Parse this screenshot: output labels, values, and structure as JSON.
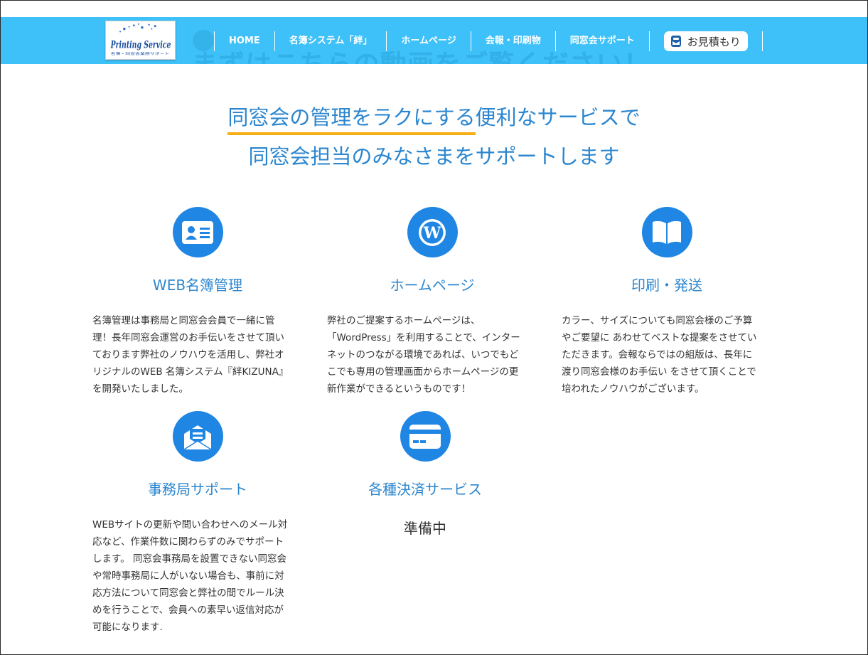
{
  "colors": {
    "nav_bg": "#3ec0f8",
    "accent": "#1f86e3",
    "heading": "#2b86cf",
    "underline": "#f6ae10"
  },
  "logo": {
    "text": "Printing Service",
    "subtext": "名簿・同窓会業務サポート"
  },
  "nav": {
    "background_text": "まずはこちらの動画をご覧ください！",
    "items": [
      "HOME",
      "名簿システム「絆」",
      "ホームページ",
      "会報・印刷物",
      "同窓会サポート"
    ],
    "quote_label": "お見積もり",
    "quote_icon": "mail-box-icon"
  },
  "headline": {
    "line1_underlined": "同窓会の管理をラクにする",
    "line1_rest": "便利なサービスで",
    "line2": "同窓会担当のみなさまをサポートします"
  },
  "features": [
    {
      "icon": "id-card-icon",
      "title": "WEB名簿管理",
      "lines": [
        "名簿管理は事務局と同窓会会員で一緒に管",
        "理！長年同窓会運営のお手伝いをさせて頂い",
        "ております弊社のノウハウを活用し、弊社オ",
        "リジナルのWEB 名簿システム『絆KIZUNA』",
        "を開発いたしました。"
      ]
    },
    {
      "icon": "wordpress-icon",
      "title": "ホームページ",
      "lines": [
        "弊社のご提案するホームページは、",
        "「WordPress」を利用することで、インター",
        "ネットのつながる環境であれば、いつでもど",
        "こでも専用の管理画面からホームページの更",
        "新作業ができるというものです！"
      ]
    },
    {
      "icon": "open-book-icon",
      "title": "印刷・発送",
      "lines": [
        "カラー、サイズについても同窓会様のご予算",
        "やご要望に あわせてベストな提案をさせてい",
        "ただきます。会報ならではの組版は、長年に",
        "渡り同窓会様のお手伝い をさせて頂くことで",
        "培われたノウハウがございます。"
      ]
    },
    {
      "icon": "envelope-letter-icon",
      "title": "事務局サポート",
      "lines": [
        "WEBサイトの更新や問い合わせへのメール対",
        "応など、作業件数に関わらずのみでサポート",
        "します。 同窓会事務局を設置できない同窓会",
        "や常時事務局に人がいない場合も、事前に対",
        "応方法について同窓会と弊社の間でルール決",
        "めを行うことで、会員への素早い返信対応が",
        "可能になります."
      ]
    },
    {
      "icon": "credit-card-icon",
      "title": "各種決済サービス",
      "status": "準備中"
    }
  ]
}
